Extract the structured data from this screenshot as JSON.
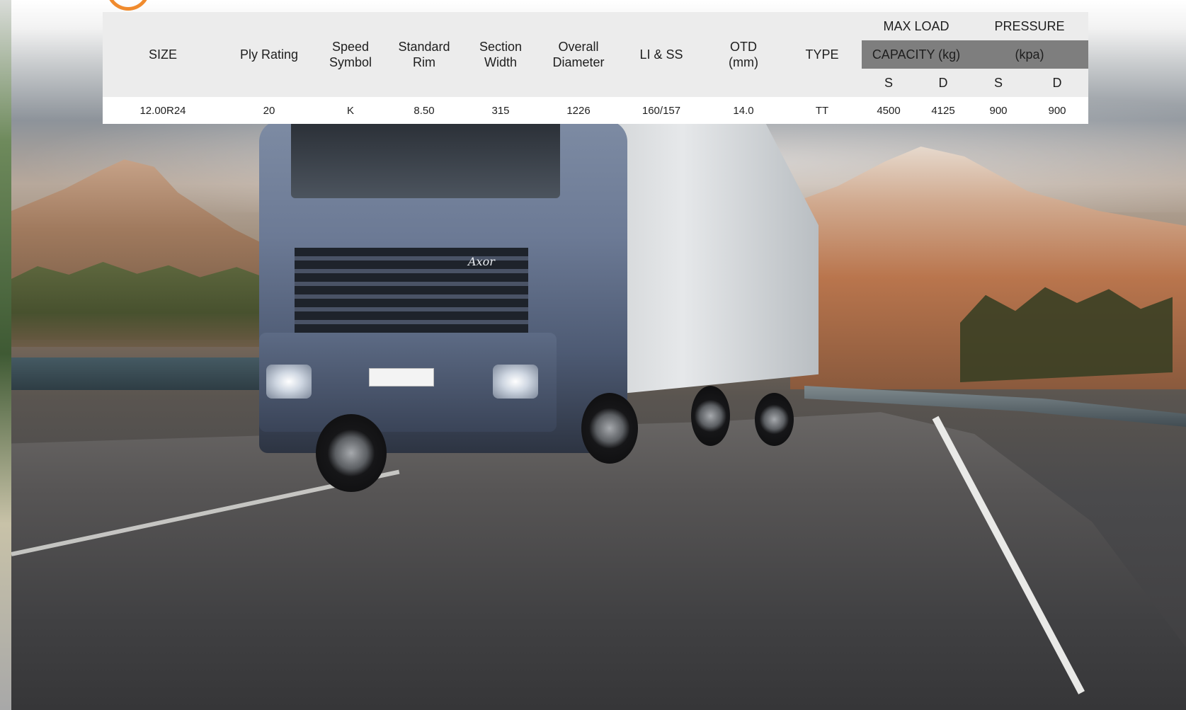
{
  "table": {
    "headers": {
      "size": "SIZE",
      "ply_rating": "Ply Rating",
      "speed_symbol_line1": "Speed",
      "speed_symbol_line2": "Symbol",
      "standard_rim_line1": "Standard",
      "standard_rim_line2": "Rim",
      "section_width_line1": "Section",
      "section_width_line2": "Width",
      "overall_diameter_line1": "Overall",
      "overall_diameter_line2": "Diameter",
      "li_ss": "LI & SS",
      "otd_line1": "OTD",
      "otd_line2": "(mm)",
      "type": "TYPE",
      "max_load_line1": "MAX LOAD",
      "max_load_line2": "CAPACITY (kg)",
      "pressure_line1": "PRESSURE",
      "pressure_line2": "(kpa)",
      "load_s": "S",
      "load_d": "D",
      "pressure_s": "S",
      "pressure_d": "D"
    },
    "rows": [
      {
        "size": "12.00R24",
        "ply_rating": "20",
        "speed_symbol": "K",
        "standard_rim": "8.50",
        "section_width": "315",
        "overall_diameter": "1226",
        "li_ss": "160/157",
        "otd": "14.0",
        "type": "TT",
        "load_s": "4500",
        "load_d": "4125",
        "pressure_s": "900",
        "pressure_d": "900"
      }
    ]
  },
  "photo": {
    "truck_badge": "Axor"
  },
  "colors": {
    "table_bg": "#ececec",
    "header_highlight": "#7e7e7e",
    "logo_accent": "#f08b2e"
  }
}
